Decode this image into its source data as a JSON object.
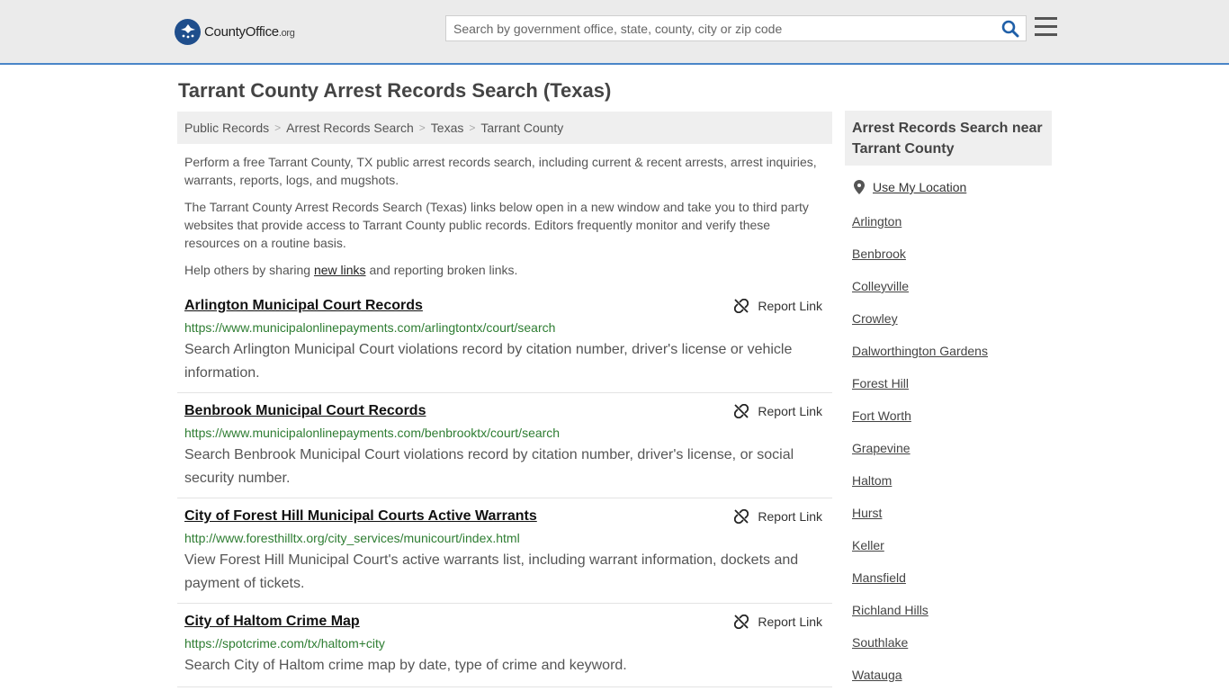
{
  "header": {
    "logo_main": "CountyOffice",
    "logo_suffix": ".org",
    "search_placeholder": "Search by government office, state, county, city or zip code",
    "search_icon": "search-icon",
    "menu_icon": "hamburger-menu-icon"
  },
  "page_title": "Tarrant County Arrest Records Search (Texas)",
  "breadcrumb": [
    "Public Records",
    "Arrest Records Search",
    "Texas",
    "Tarrant County"
  ],
  "breadcrumb_separator": ">",
  "intro": {
    "p1": "Perform a free Tarrant County, TX public arrest records search, including current & recent arrests, arrest inquiries, warrants, reports, logs, and mugshots.",
    "p2": "The Tarrant County Arrest Records Search (Texas) links below open in a new window and take you to third party websites that provide access to Tarrant County public records. Editors frequently monitor and verify these resources on a routine basis.",
    "p3_before": "Help others by sharing ",
    "p3_link": "new links",
    "p3_after": " and reporting broken links."
  },
  "report_label": "Report Link",
  "results": [
    {
      "title": "Arlington Municipal Court Records",
      "url": "https://www.municipalonlinepayments.com/arlingtontx/court/search",
      "desc": "Search Arlington Municipal Court violations record by citation number, driver's license or vehicle information."
    },
    {
      "title": "Benbrook Municipal Court Records",
      "url": "https://www.municipalonlinepayments.com/benbrooktx/court/search",
      "desc": "Search Benbrook Municipal Court violations record by citation number, driver's license, or social security number."
    },
    {
      "title": "City of Forest Hill Municipal Courts Active Warrants",
      "url": "http://www.foresthilltx.org/city_services/municourt/index.html",
      "desc": "View Forest Hill Municipal Court's active warrants list, including warrant information, dockets and payment of tickets."
    },
    {
      "title": "City of Haltom Crime Map",
      "url": "https://spotcrime.com/tx/haltom+city",
      "desc": "Search City of Haltom crime map by date, type of crime and keyword."
    }
  ],
  "sidebar": {
    "heading": "Arrest Records Search near Tarrant County",
    "use_location": "Use My Location",
    "cities": [
      "Arlington",
      "Benbrook",
      "Colleyville",
      "Crowley",
      "Dalworthington Gardens",
      "Forest Hill",
      "Fort Worth",
      "Grapevine",
      "Haltom",
      "Hurst",
      "Keller",
      "Mansfield",
      "Richland Hills",
      "Southlake",
      "Watauga"
    ]
  },
  "colors": {
    "accent_line": "#4a86c8",
    "url_green": "#2e7d32",
    "logo_blue": "#1f4e8c"
  }
}
